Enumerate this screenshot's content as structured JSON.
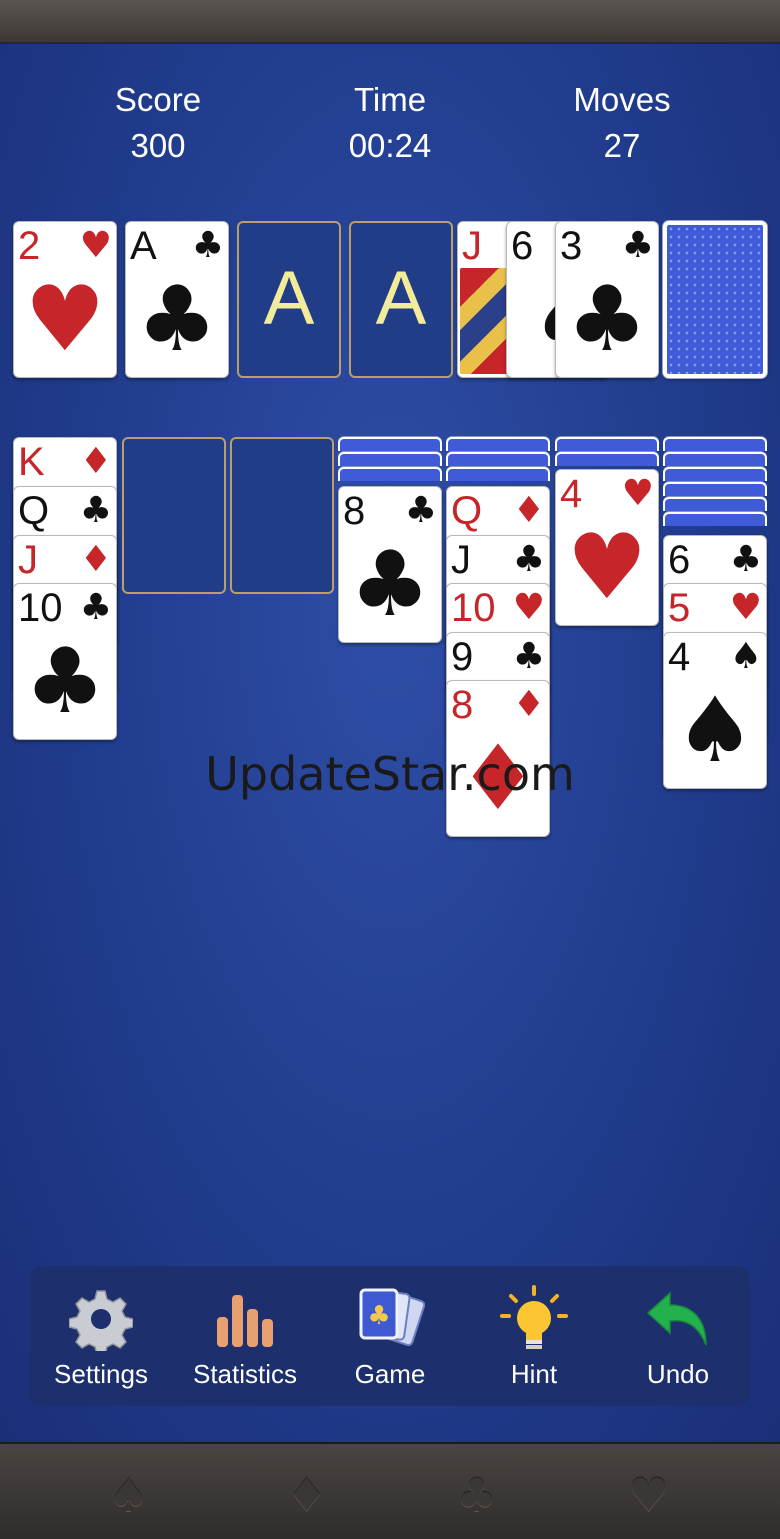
{
  "header": {
    "score_label": "Score",
    "score_value": "300",
    "time_label": "Time",
    "time_value": "00:24",
    "moves_label": "Moves",
    "moves_value": "27"
  },
  "foundations": [
    {
      "rank": "2",
      "suit": "♥",
      "color": "red"
    },
    {
      "rank": "A",
      "suit": "♣",
      "color": "black"
    },
    {
      "placeholder": "A"
    },
    {
      "placeholder": "A"
    }
  ],
  "waste": [
    {
      "rank": "J",
      "suit": "♥",
      "color": "red"
    },
    {
      "rank": "6",
      "suit": "♠",
      "color": "black"
    },
    {
      "rank": "3",
      "suit": "♣",
      "color": "black"
    }
  ],
  "tableau": {
    "col1": [
      {
        "rank": "K",
        "suit": "♦",
        "color": "red"
      },
      {
        "rank": "Q",
        "suit": "♣",
        "color": "black"
      },
      {
        "rank": "J",
        "suit": "♦",
        "color": "red"
      },
      {
        "rank": "10",
        "suit": "♣",
        "color": "black"
      }
    ],
    "col4": [
      {
        "rank": "8",
        "suit": "♣",
        "color": "black"
      }
    ],
    "col5": [
      {
        "rank": "Q",
        "suit": "♦",
        "color": "red"
      },
      {
        "rank": "J",
        "suit": "♣",
        "color": "black"
      },
      {
        "rank": "10",
        "suit": "♥",
        "color": "red"
      },
      {
        "rank": "9",
        "suit": "♣",
        "color": "black"
      },
      {
        "rank": "8",
        "suit": "♦",
        "color": "red"
      }
    ],
    "col6": [
      {
        "rank": "4",
        "suit": "♥",
        "color": "red"
      }
    ],
    "col7": [
      {
        "rank": "6",
        "suit": "♣",
        "color": "black"
      },
      {
        "rank": "5",
        "suit": "♥",
        "color": "red"
      },
      {
        "rank": "4",
        "suit": "♠",
        "color": "black"
      }
    ]
  },
  "watermark": "UpdateStar.com",
  "toolbar": {
    "settings": "Settings",
    "statistics": "Statistics",
    "game": "Game",
    "hint": "Hint",
    "undo": "Undo"
  },
  "footer_suits": [
    "♠",
    "♦",
    "♣",
    "♥"
  ],
  "colors": {
    "felt": "#233f92",
    "card_red": "#c6252a",
    "card_back": "#3f5bd8",
    "slot_border": "#b9a068"
  }
}
